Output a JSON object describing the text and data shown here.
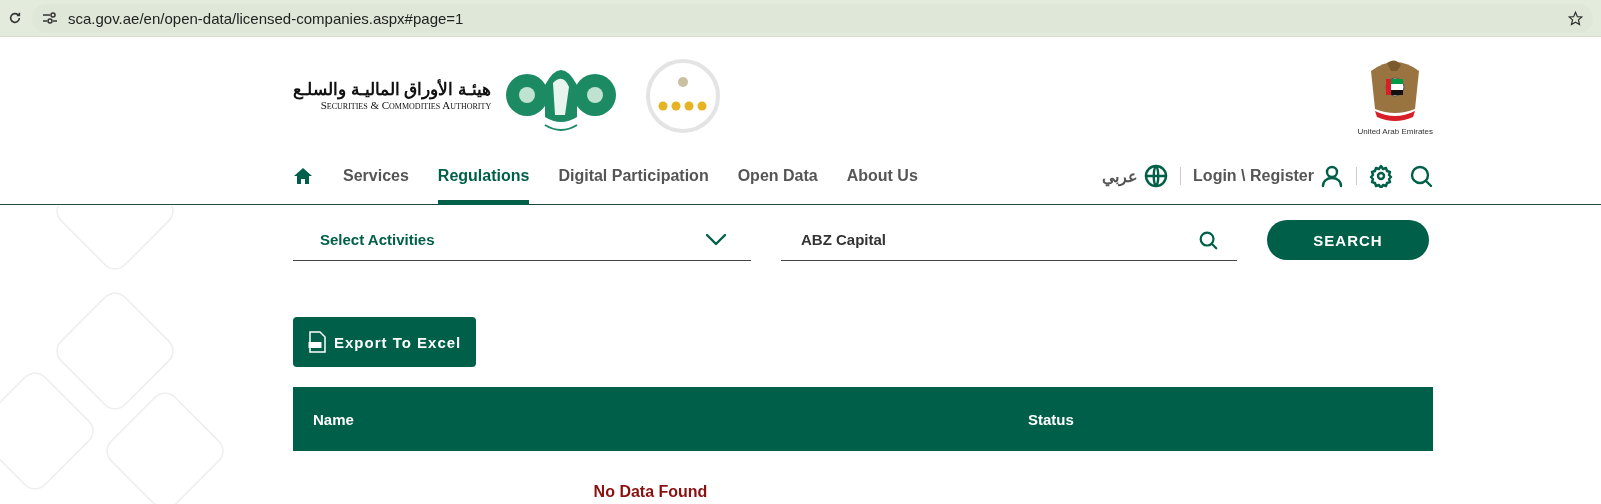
{
  "browser": {
    "url": "sca.gov.ae/en/open-data/licensed-companies.aspx#page=1"
  },
  "header": {
    "logo_arabic": "هيئـة الأوراق الماليـة والسلـع",
    "logo_english": "Securities & Commodities Authority",
    "emblem_caption": "United Arab Emirates"
  },
  "nav": {
    "items": [
      {
        "label": "Services",
        "selected": false
      },
      {
        "label": "Regulations",
        "selected": true
      },
      {
        "label": "Digital Participation",
        "selected": false
      },
      {
        "label": "Open Data",
        "selected": false
      },
      {
        "label": "About Us",
        "selected": false
      }
    ],
    "language": "عربي",
    "login": "Login \\ Register"
  },
  "filters": {
    "activity": {
      "placeholder": "Select Activities"
    },
    "search": {
      "value": "ABZ Capital"
    },
    "button": "SEARCH"
  },
  "export_button": "Export To Excel",
  "table": {
    "columns": [
      "Name",
      "Status"
    ],
    "empty_message": "No Data Found"
  }
}
